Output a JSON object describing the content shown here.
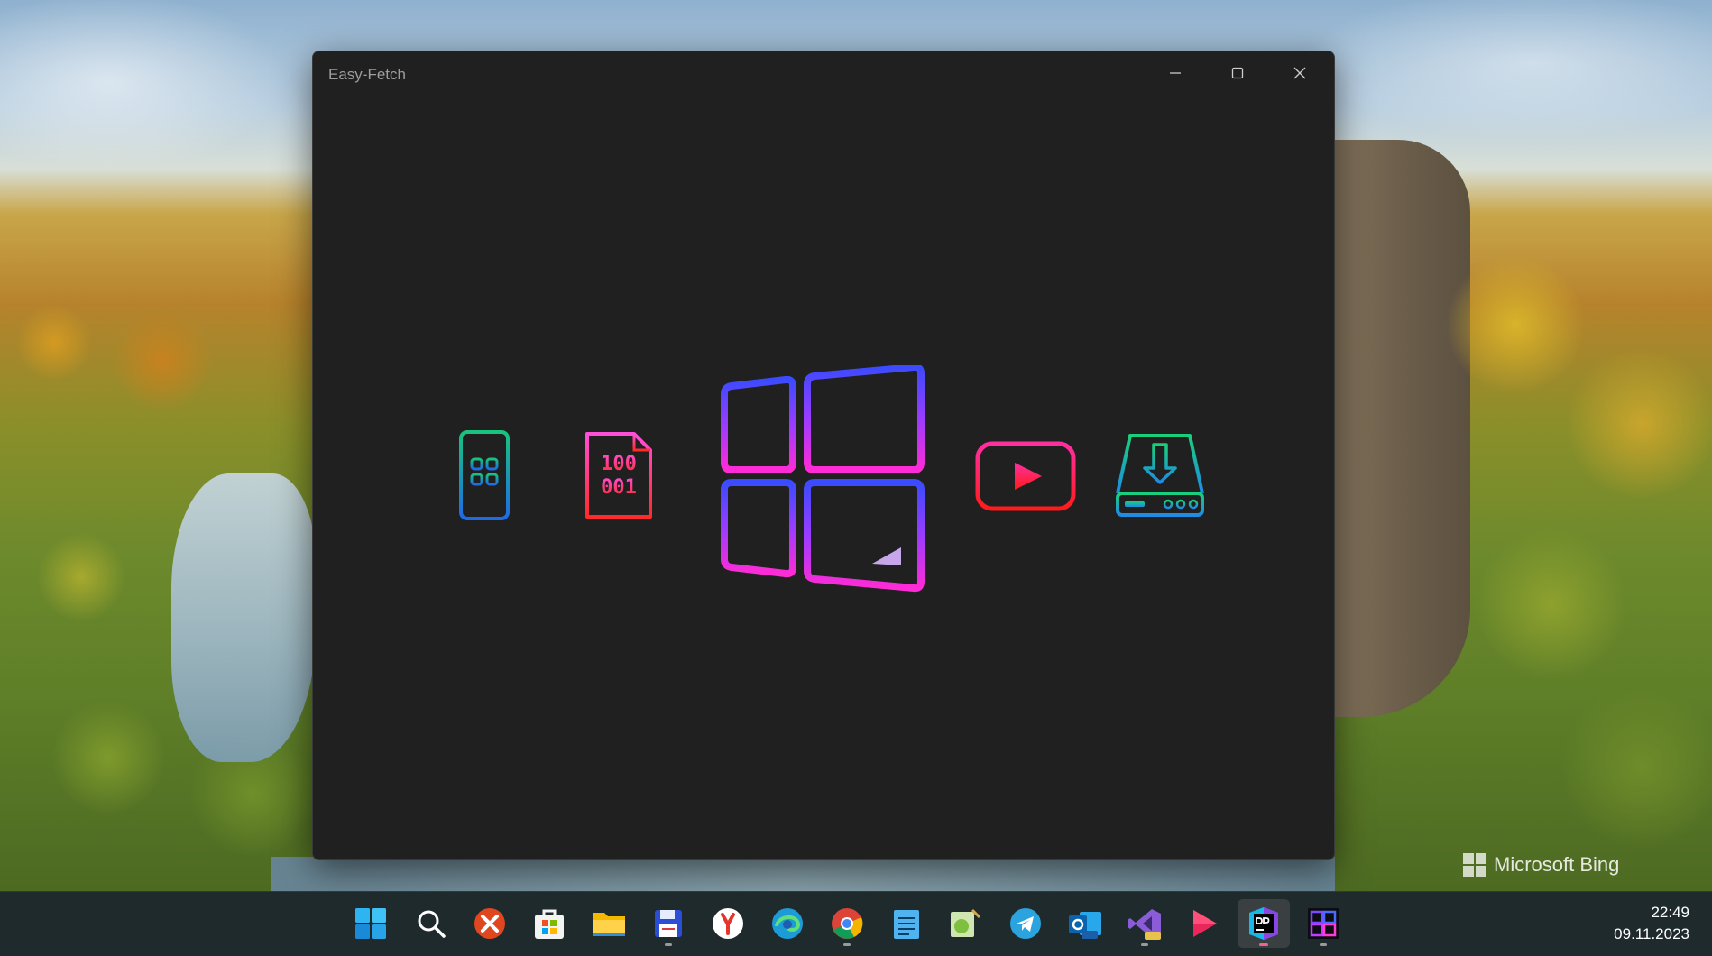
{
  "window": {
    "title": "Easy-Fetch",
    "minimize_icon": "minimize-icon",
    "maximize_icon": "maximize-icon",
    "close_icon": "close-icon"
  },
  "features": [
    {
      "name": "mobile-apps-icon",
      "color_start": "#19c37d",
      "color_end": "#1e6be6"
    },
    {
      "name": "binary-file-icon",
      "text_top": "100",
      "text_bottom": "001",
      "color_start": "#ff4fd8",
      "color_end": "#ff2a2a"
    },
    {
      "name": "windows-logo-icon",
      "color_start": "#3b4bff",
      "color_end": "#ff2bd6"
    },
    {
      "name": "youtube-play-icon",
      "color_start": "#ff2fa0",
      "color_end": "#ff1b1b"
    },
    {
      "name": "download-drive-icon",
      "color_start": "#19d07a",
      "color_end": "#1e8be6"
    }
  ],
  "desktop": {
    "watermark": "Microsoft Bing"
  },
  "taskbar": {
    "apps": [
      "start-icon",
      "search-icon",
      "anydesk-icon",
      "microsoft-store-icon",
      "file-explorer-icon",
      "floppy-save-icon",
      "yandex-browser-icon",
      "edge-icon",
      "chrome-icon",
      "notepad-icon",
      "notepad-plus-plus-icon",
      "telegram-icon",
      "outlook-preview-icon",
      "visual-studio-preview-icon",
      "media-player-icon",
      "dotpeek-icon",
      "app-grid-icon"
    ],
    "time": "22:49",
    "date": "09.11.2023"
  }
}
